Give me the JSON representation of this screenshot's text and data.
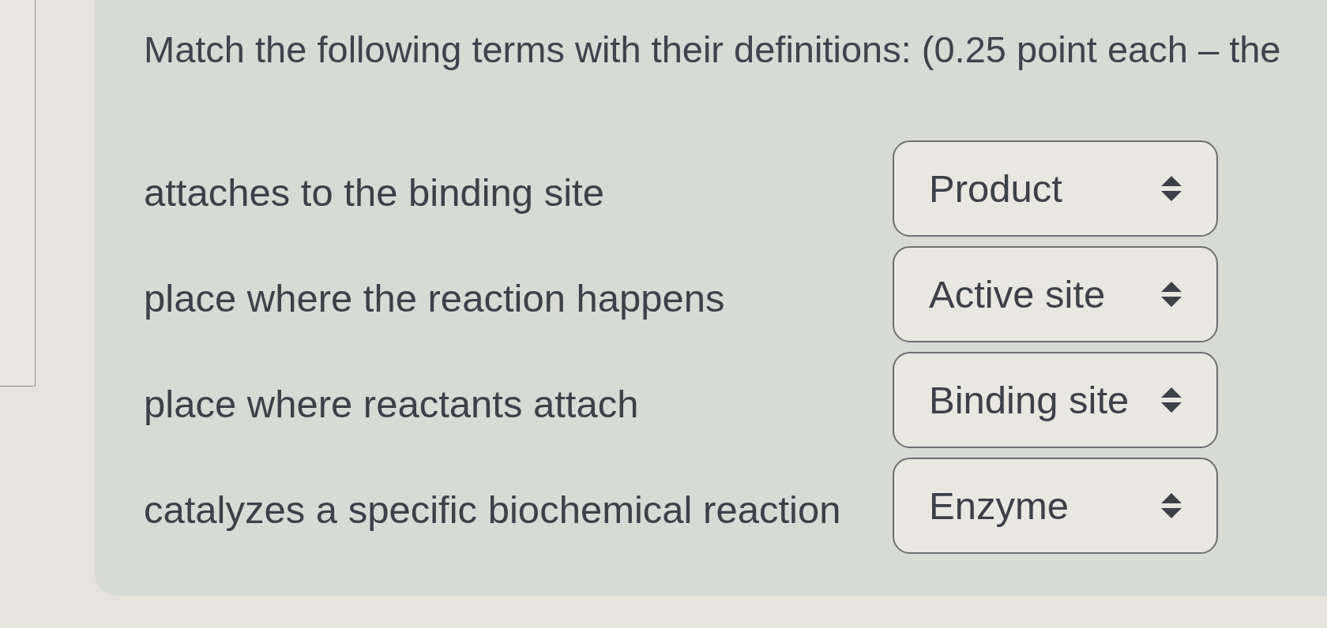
{
  "question": {
    "prompt": "Match the following terms with their definitions: (0.25 point each – the"
  },
  "matches": [
    {
      "definition": "attaches to the binding site",
      "answer": "Product"
    },
    {
      "definition": "place where the reaction happens",
      "answer": "Active site"
    },
    {
      "definition": "place where reactants attach",
      "answer": "Binding site"
    },
    {
      "definition": "catalyzes a specific biochemical reaction",
      "answer": "Enzyme"
    }
  ]
}
